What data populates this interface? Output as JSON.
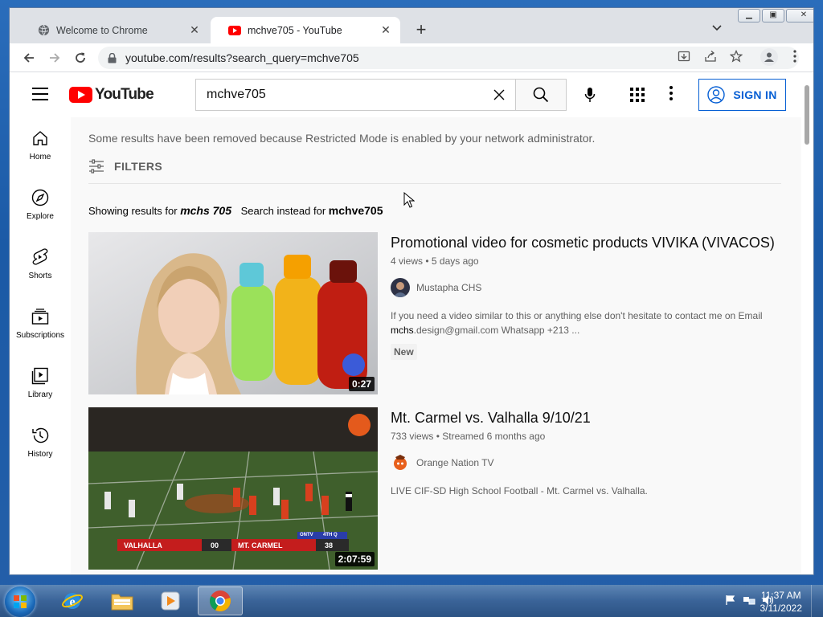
{
  "browser": {
    "tabs": [
      {
        "title": "Welcome to Chrome",
        "active": false
      },
      {
        "title": "mchve705 - YouTube",
        "active": true
      }
    ],
    "url": "youtube.com/results?search_query=mchve705"
  },
  "youtube": {
    "logo_text": "YouTube",
    "search_query": "mchve705",
    "sign_in_label": "SIGN IN",
    "guide": [
      {
        "label": "Home",
        "icon": "home-icon"
      },
      {
        "label": "Explore",
        "icon": "explore-icon"
      },
      {
        "label": "Shorts",
        "icon": "shorts-icon"
      },
      {
        "label": "Subscriptions",
        "icon": "subscriptions-icon"
      },
      {
        "label": "Library",
        "icon": "library-icon"
      },
      {
        "label": "History",
        "icon": "history-icon"
      }
    ],
    "restricted_notice": "Some results have been removed because Restricted Mode is enabled by your network administrator.",
    "filters_label": "FILTERS",
    "showing_prefix": "Showing results for",
    "showing_term": "mchs 705",
    "instead_prefix": "Search instead for",
    "instead_term": "mchve705",
    "results": [
      {
        "title": "Promotional video for cosmetic products VIVIKA (VIVACOS)",
        "views": "4 views",
        "age": "5 days ago",
        "channel": "Mustapha CHS",
        "desc_bold": "mchs",
        "desc_pre": "If you need a video similar to this or anything else don't hesitate to contact me on Email ",
        "desc_post": ".design@gmail.com Whatsapp +213 ...",
        "badge": "New",
        "duration": "0:27"
      },
      {
        "title": "Mt. Carmel vs. Valhalla 9/10/21",
        "views": "733 views",
        "age": "Streamed 6 months ago",
        "channel": "Orange Nation TV",
        "desc": "LIVE CIF-SD High School Football - Mt. Carmel vs. Valhalla.",
        "duration": "2:07:59",
        "scoreboard": {
          "team1": "VALHALLA",
          "score1": "00",
          "team2": "MT. CARMEL",
          "score2": "38",
          "network": "ONTV",
          "quarter": "4TH Q"
        }
      }
    ]
  },
  "taskbar": {
    "time": "11:37 AM",
    "date": "3/11/2022"
  }
}
